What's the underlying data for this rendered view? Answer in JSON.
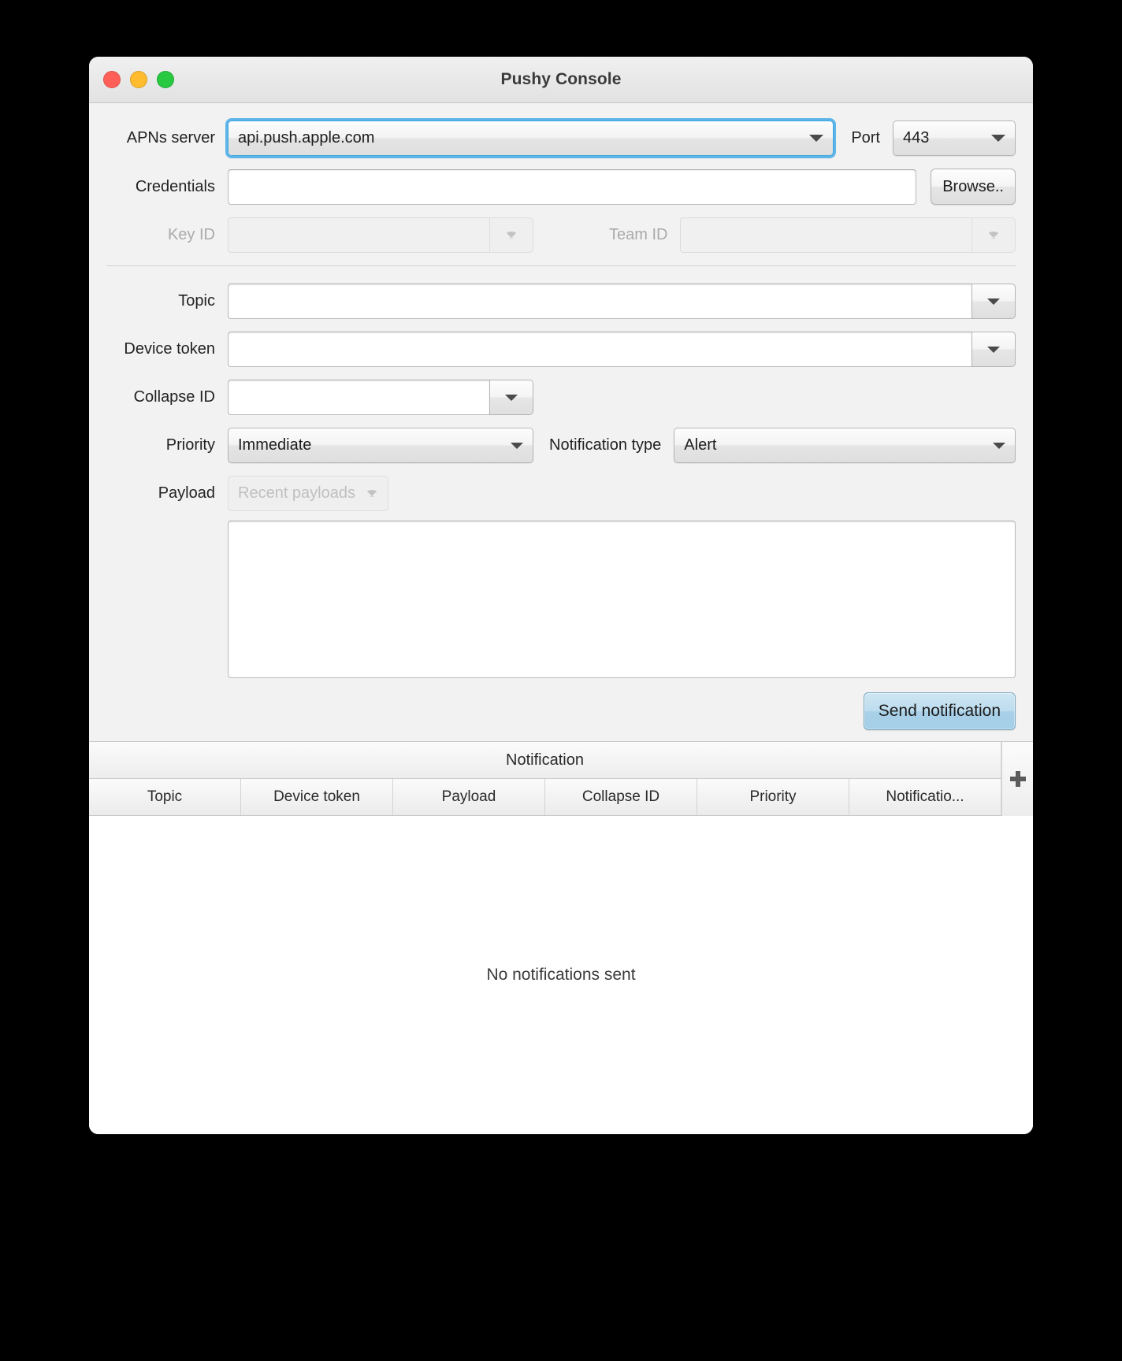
{
  "window": {
    "title": "Pushy Console",
    "traffic_lights": [
      {
        "name": "close",
        "color": "#ff5f57"
      },
      {
        "name": "minimize",
        "color": "#febc2e"
      },
      {
        "name": "maximize",
        "color": "#28c840"
      }
    ]
  },
  "form": {
    "apns_server": {
      "label": "APNs server",
      "value": "api.push.apple.com",
      "focused": true
    },
    "port": {
      "label": "Port",
      "value": "443"
    },
    "credentials": {
      "label": "Credentials",
      "value": "",
      "placeholder": "",
      "browse_label": "Browse.."
    },
    "key_id": {
      "label": "Key ID",
      "value": "",
      "disabled": true
    },
    "team_id": {
      "label": "Team ID",
      "value": "",
      "disabled": true
    },
    "topic": {
      "label": "Topic",
      "value": ""
    },
    "device_token": {
      "label": "Device token",
      "value": ""
    },
    "collapse_id": {
      "label": "Collapse ID",
      "value": ""
    },
    "priority": {
      "label": "Priority",
      "value": "Immediate"
    },
    "notification_type": {
      "label": "Notification type",
      "value": "Alert"
    },
    "payload": {
      "label": "Payload",
      "recent_label": "Recent payloads",
      "recent_disabled": true,
      "text": ""
    },
    "send_button": {
      "label": "Send notification",
      "accent": "#a8d0e8"
    }
  },
  "table": {
    "group_header": "Notification",
    "columns": [
      "Topic",
      "Device token",
      "Payload",
      "Collapse ID",
      "Priority",
      "Notificatio..."
    ],
    "add_column_icon": "plus-icon",
    "rows": [],
    "empty_message": "No notifications sent"
  }
}
